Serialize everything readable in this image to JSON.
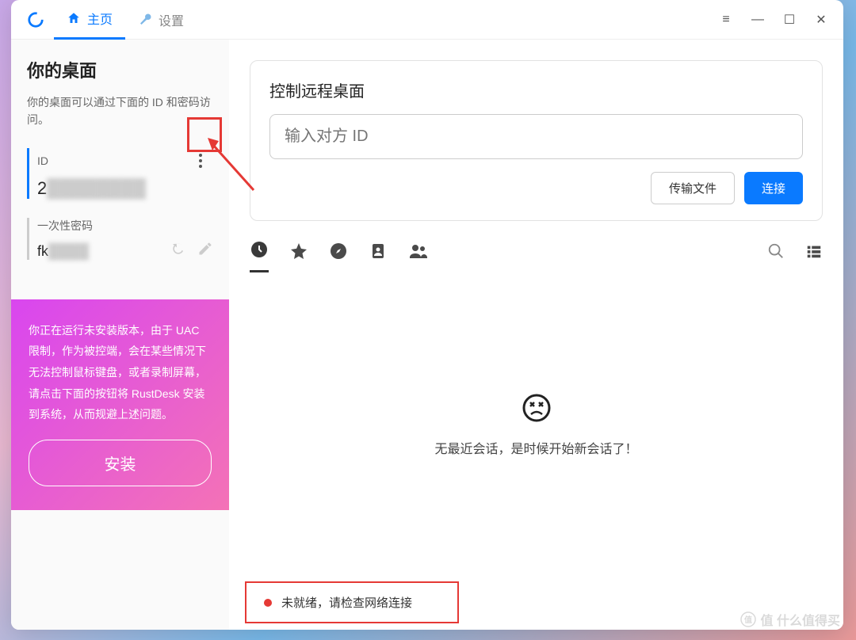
{
  "titlebar": {
    "tabs": {
      "home": "主页",
      "settings": "设置"
    }
  },
  "sidebar": {
    "title": "你的桌面",
    "subtitle": "你的桌面可以通过下面的 ID 和密码访问。",
    "id_label": "ID",
    "id_value": "2",
    "pwd_label": "一次性密码",
    "pwd_value": "fk"
  },
  "install": {
    "text": "你正在运行未安装版本，由于 UAC 限制，作为被控端，会在某些情况下无法控制鼠标键盘，或者录制屏幕，请点击下面的按钮将 RustDesk 安装到系统，从而规避上述问题。",
    "button": "安装"
  },
  "remote": {
    "title": "控制远程桌面",
    "placeholder": "输入对方 ID",
    "transfer": "传输文件",
    "connect": "连接"
  },
  "empty": {
    "text": "无最近会话，是时候开始新会话了！"
  },
  "status": {
    "text": "未就绪，请检查网络连接"
  },
  "watermark": "值 什么值得买"
}
